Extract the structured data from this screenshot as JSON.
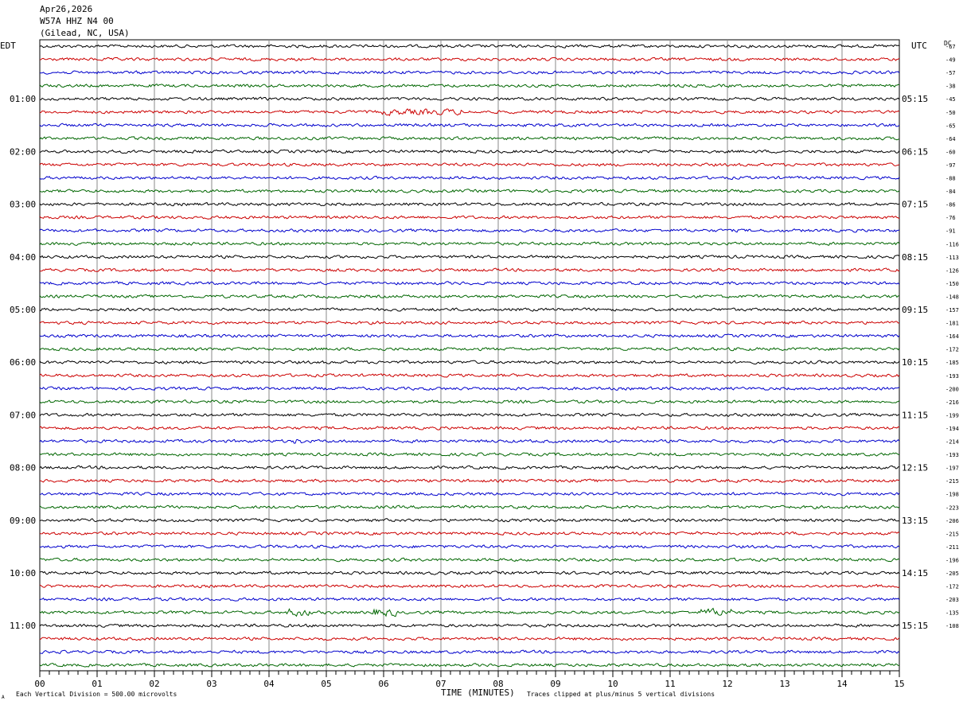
{
  "header": {
    "date": "Apr26,2026",
    "station": "W57A HHZ N4 00",
    "location": "(Gilead, NC, USA)"
  },
  "chart_data": {
    "type": "line",
    "title": "Apr26,2026",
    "left_axis_label": "EDT",
    "right_axis_label": "UTC",
    "dc_label": "DC",
    "xlabel": "TIME (MINUTES)",
    "xlim": [
      0,
      15
    ],
    "x_ticks": [
      "00",
      "01",
      "02",
      "03",
      "04",
      "05",
      "06",
      "07",
      "08",
      "09",
      "10",
      "11",
      "12",
      "13",
      "14",
      "15"
    ],
    "left_hour_labels": [
      "01:00",
      "02:00",
      "03:00",
      "04:00",
      "05:00",
      "06:00",
      "07:00",
      "08:00",
      "09:00",
      "10:00",
      "11:00"
    ],
    "right_hour_labels": [
      "05:15",
      "06:15",
      "07:15",
      "08:15",
      "09:15",
      "10:15",
      "11:15",
      "12:15",
      "13:15",
      "14:15",
      "15:15"
    ],
    "trace_colors": [
      "#000000",
      "#cc0000",
      "#0000cc",
      "#006600"
    ],
    "trace_count": 48,
    "dc_offsets": [
      -67,
      -49,
      -57,
      -38,
      -45,
      -50,
      -65,
      -64,
      -60,
      -97,
      -88,
      -84,
      -86,
      -76,
      -91,
      -116,
      -113,
      -126,
      -150,
      -148,
      -157,
      -181,
      -164,
      -172,
      -185,
      -193,
      -200,
      -216,
      -199,
      -194,
      -214,
      -193,
      -197,
      -215,
      -198,
      -223,
      -206,
      -215,
      -211,
      -196,
      -205,
      -172,
      -203,
      -135,
      -108
    ],
    "footer_scale": "Each Vertical Division =  500.00 microvolts",
    "footer_clip": "Traces clipped at plus/minus 5 vertical divisions",
    "footer_corner": "A",
    "grid": true
  }
}
